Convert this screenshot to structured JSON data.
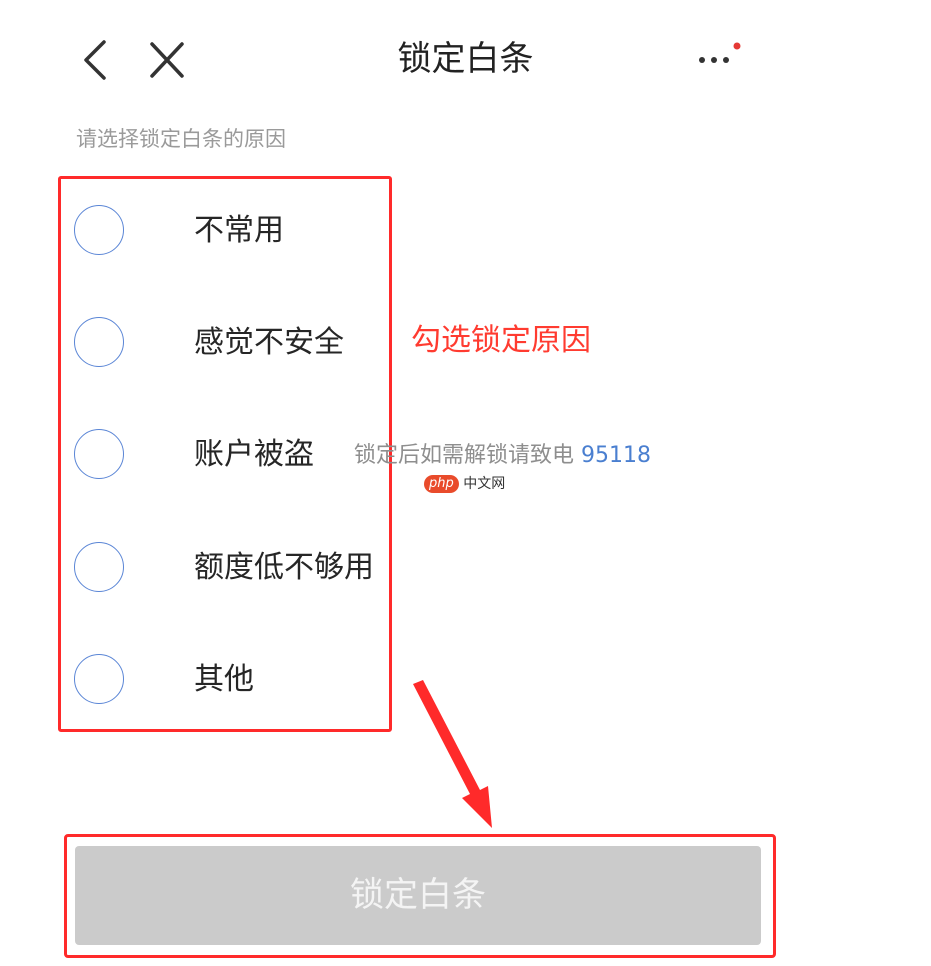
{
  "header": {
    "title": "锁定白条",
    "back_icon": "chevron-left-icon",
    "close_icon": "close-icon",
    "more_icon": "more-dots-icon",
    "notify_dot_color": "#e53935"
  },
  "subtitle": "请选择锁定白条的原因",
  "options": [
    {
      "label": "不常用",
      "selected": false
    },
    {
      "label": "感觉不安全",
      "selected": false
    },
    {
      "label": "账户被盗",
      "selected": false
    },
    {
      "label": "额度低不够用",
      "selected": false
    },
    {
      "label": "其他",
      "selected": false
    }
  ],
  "annotation": "勾选锁定原因",
  "hint": {
    "text": "锁定后如需解锁请致电",
    "phone": "95118"
  },
  "watermark": {
    "logo": "php",
    "text": "中文网"
  },
  "lock_button": {
    "label": "锁定白条",
    "enabled": false
  },
  "colors": {
    "annotation_red": "#ff2a2a",
    "radio_blue": "#5b86d6",
    "phone_blue": "#4a7fd0",
    "button_disabled": "#cbcbcb"
  }
}
